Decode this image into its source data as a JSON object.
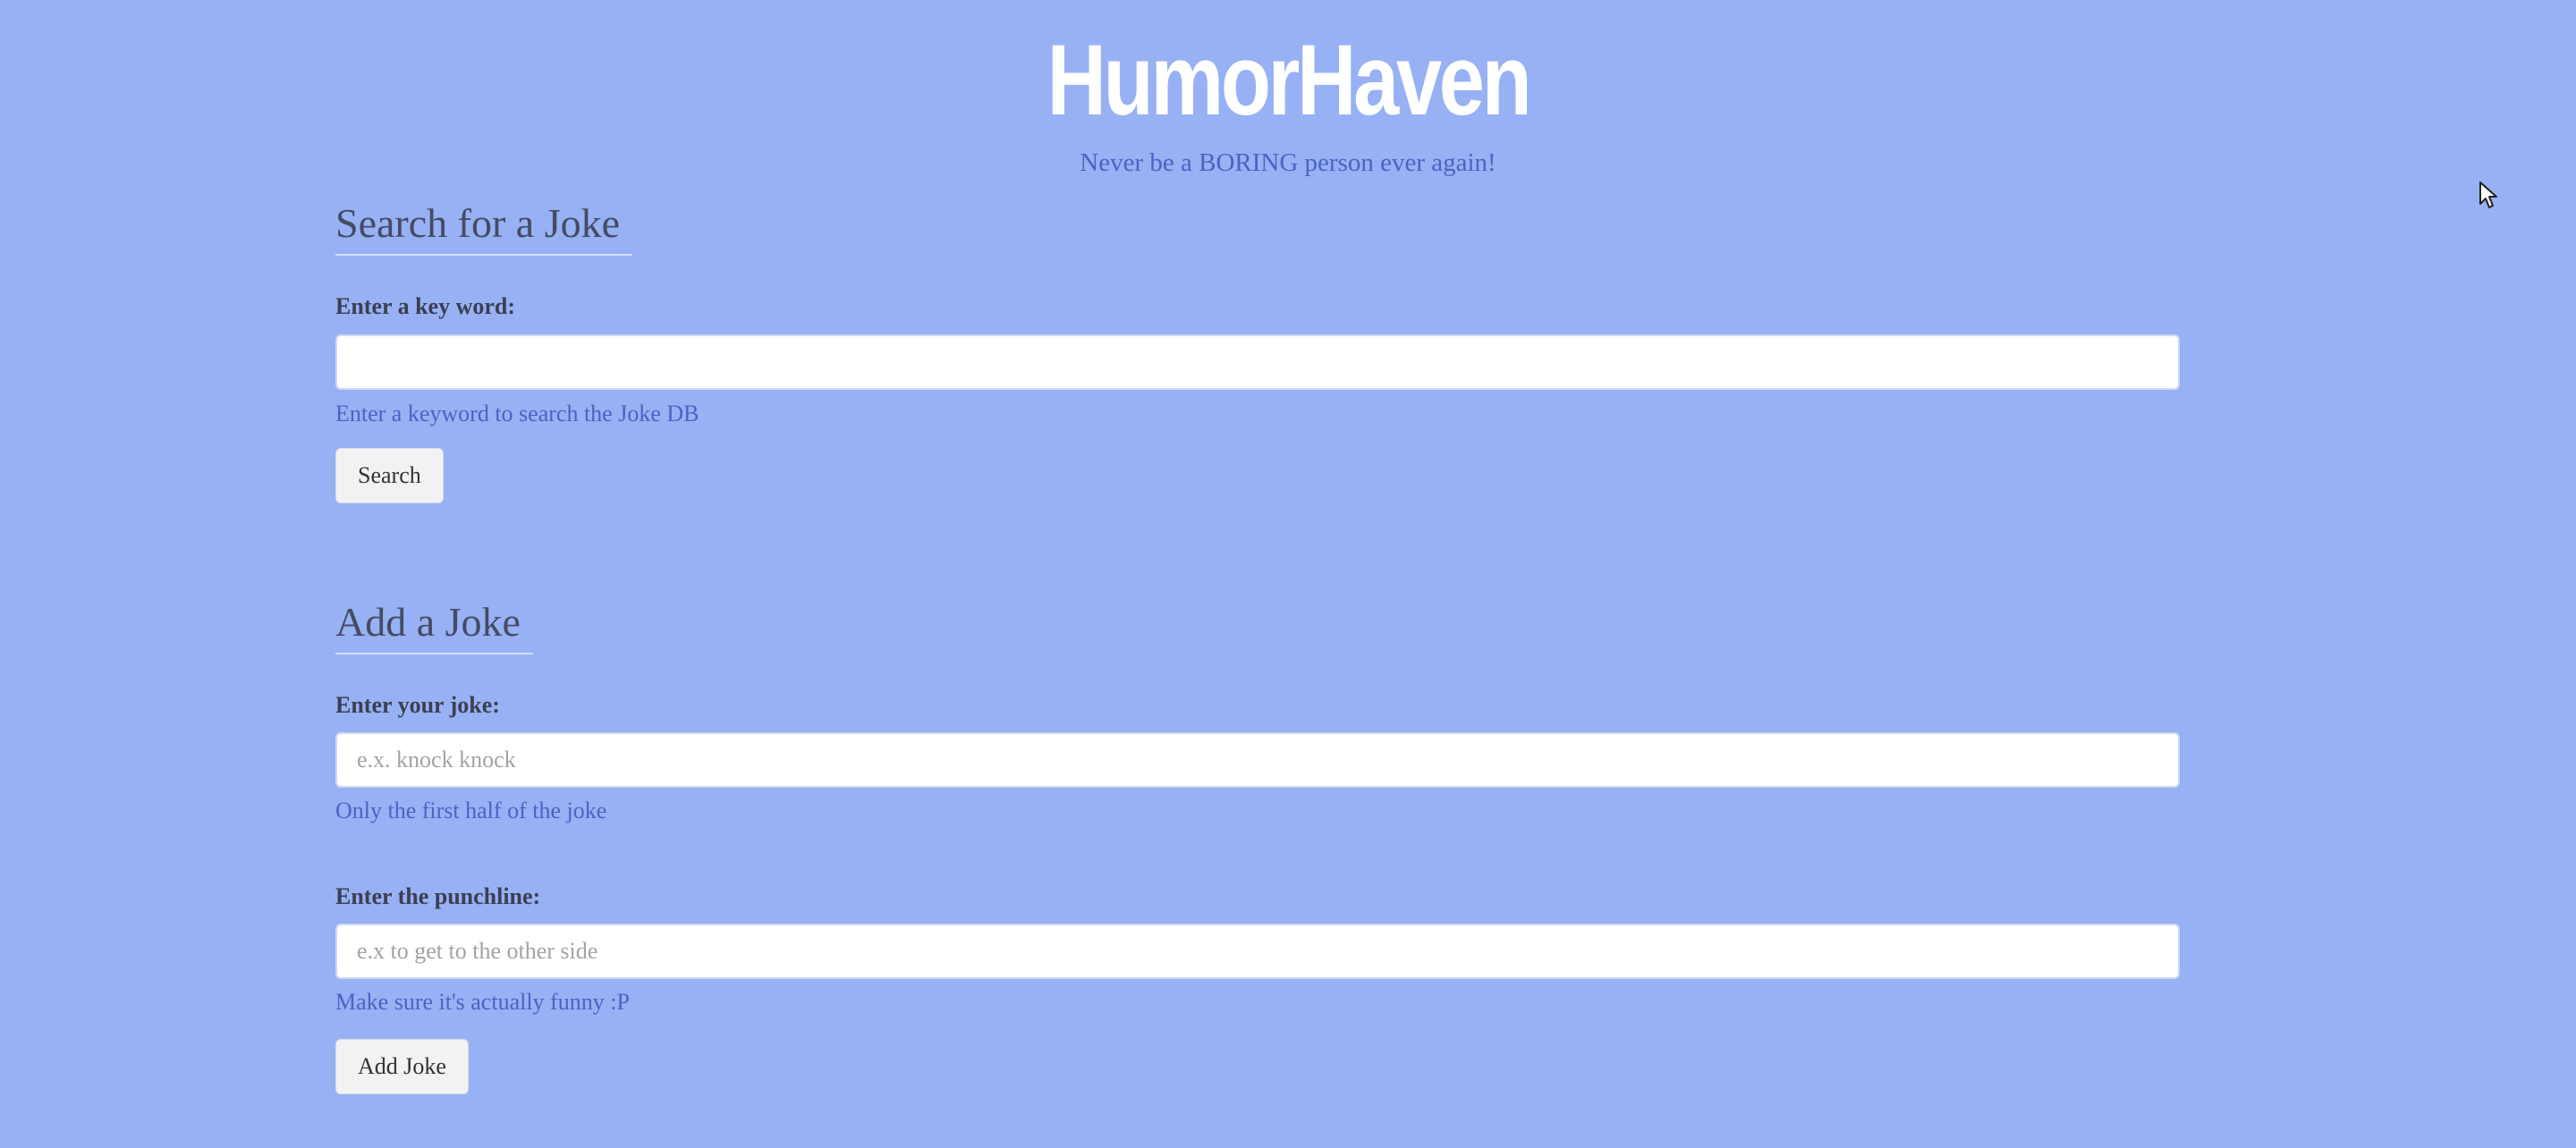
{
  "header": {
    "title": "HumorHaven",
    "tagline": "Never be a BORING person ever again!"
  },
  "search_section": {
    "heading": "Search for a Joke",
    "keyword_label": "Enter a key word:",
    "keyword_value": "",
    "keyword_placeholder": "",
    "help_text": "Enter a keyword to search the Joke DB",
    "button_label": "Search"
  },
  "add_section": {
    "heading": "Add a Joke",
    "joke_label": "Enter your joke:",
    "joke_value": "",
    "joke_placeholder": "e.x. knock knock",
    "joke_help": "Only the first half of the joke",
    "punchline_label": "Enter the punchline:",
    "punchline_value": "",
    "punchline_placeholder": "e.x to get to the other side",
    "punchline_help": "Make sure it's actually funny :P",
    "button_label": "Add Joke"
  },
  "colors": {
    "background": "#97b1f4",
    "title": "#ffffff",
    "accent_text": "#4b63c4",
    "heading_text": "#454b63"
  },
  "icons": {
    "cursor": "mouse-pointer-icon"
  }
}
